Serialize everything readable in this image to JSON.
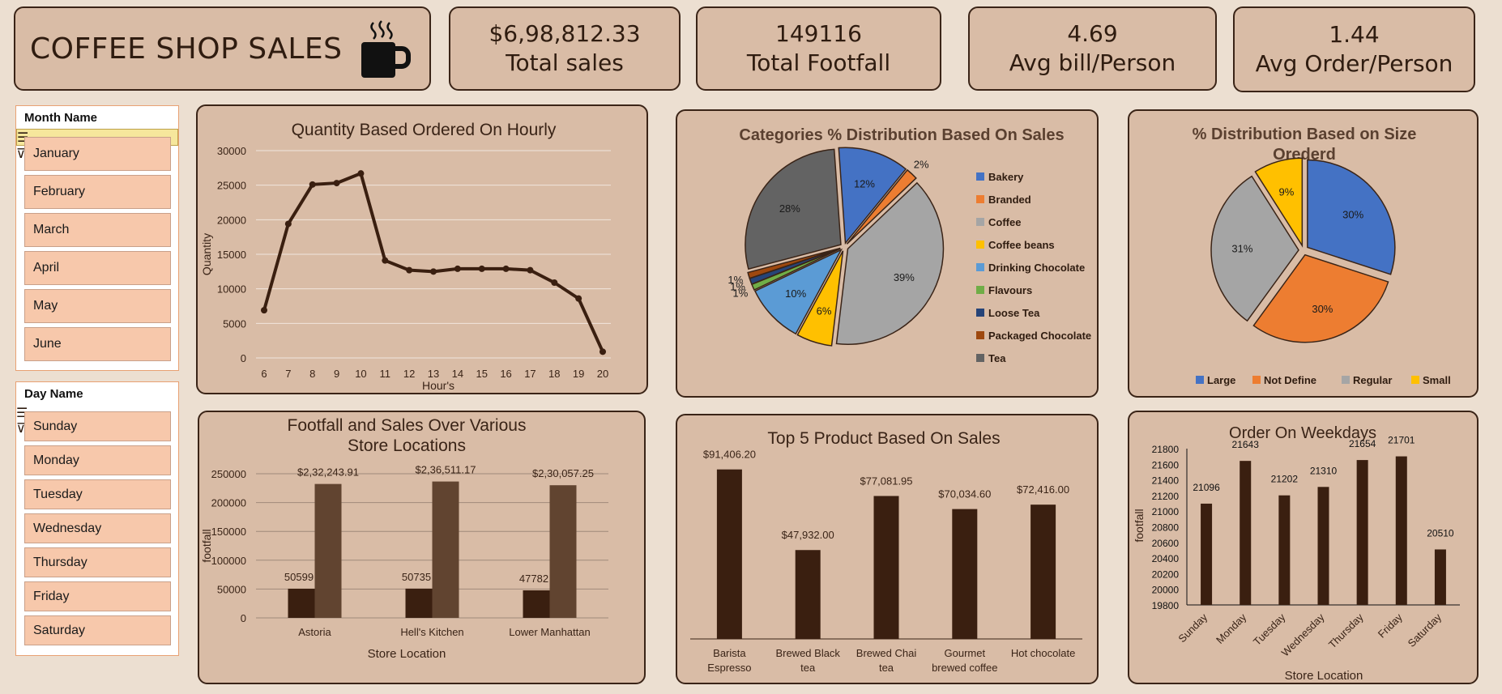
{
  "header": {
    "title": "COFFEE SHOP SALES"
  },
  "kpis": [
    {
      "value": "$6,98,812.33",
      "label": "Total sales"
    },
    {
      "value": "149116",
      "label": "Total Footfall"
    },
    {
      "value": "4.69",
      "label": "Avg bill/Person"
    },
    {
      "value": "1.44",
      "label": "Avg Order/Person"
    }
  ],
  "slicers": {
    "month": {
      "title": "Month Name",
      "items": [
        "January",
        "February",
        "March",
        "April",
        "May",
        "June"
      ]
    },
    "day": {
      "title": "Day Name",
      "items": [
        "Sunday",
        "Monday",
        "Tuesday",
        "Wednesday",
        "Thursday",
        "Friday",
        "Saturday"
      ]
    }
  },
  "colors": {
    "dark": "#3a1f10",
    "mid": "#614430",
    "card": "#d9bca6",
    "bg": "#ecdfd1"
  },
  "chart_data": [
    {
      "id": "hourly",
      "type": "line",
      "title": "Quantity Based Ordered On Hourly",
      "xlabel": "Hour's",
      "ylabel": "Quantity",
      "x": [
        6,
        7,
        8,
        9,
        10,
        11,
        12,
        13,
        14,
        15,
        16,
        17,
        18,
        19,
        20
      ],
      "values": [
        6900,
        19400,
        25100,
        25300,
        26700,
        14100,
        12700,
        12500,
        12900,
        12900,
        12900,
        12700,
        10900,
        8600,
        900
      ],
      "ylim": [
        0,
        30000
      ],
      "yticks": [
        0,
        5000,
        10000,
        15000,
        20000,
        25000,
        30000
      ],
      "grid": true
    },
    {
      "id": "categories",
      "type": "pie",
      "title": "Categories % Distribution Based On Sales",
      "legend": "right",
      "slices": [
        {
          "name": "Bakery",
          "value": 12,
          "label": "12%",
          "color": "#4472c4"
        },
        {
          "name": "Branded",
          "value": 2,
          "label": "2%",
          "color": "#ed7d31"
        },
        {
          "name": "Coffee",
          "value": 39,
          "label": "39%",
          "color": "#a5a5a5"
        },
        {
          "name": "Coffee beans",
          "value": 6,
          "label": "6%",
          "color": "#ffc000"
        },
        {
          "name": "Drinking Chocolate",
          "value": 10,
          "label": "10%",
          "color": "#5b9bd5"
        },
        {
          "name": "Flavours",
          "value": 1,
          "label": "1%",
          "color": "#70ad47"
        },
        {
          "name": "Loose Tea",
          "value": 1,
          "label": "1%",
          "color": "#264478"
        },
        {
          "name": "Packaged Chocolate",
          "value": 1,
          "label": "1%",
          "color": "#9e480e"
        },
        {
          "name": "Tea",
          "value": 28,
          "label": "28%",
          "color": "#636363"
        }
      ]
    },
    {
      "id": "size",
      "type": "pie",
      "title": "% Distribution Based on Size Orederd",
      "legend": "bottom",
      "slices": [
        {
          "name": "Large",
          "value": 30,
          "label": "30%",
          "color": "#4472c4"
        },
        {
          "name": "Not Define",
          "value": 30,
          "label": "30%",
          "color": "#ed7d31"
        },
        {
          "name": "Regular",
          "value": 31,
          "label": "31%",
          "color": "#a5a5a5"
        },
        {
          "name": "Small",
          "value": 9,
          "label": "9%",
          "color": "#ffc000"
        }
      ]
    },
    {
      "id": "stores",
      "type": "bar",
      "title": "Footfall and Sales Over Various Store Locations",
      "xlabel": "Store Location",
      "ylabel": "footfall",
      "categories": [
        "Astoria",
        "Hell's Kitchen",
        "Lower Manhattan"
      ],
      "series": [
        {
          "values": [
            50599,
            50735,
            47782
          ],
          "labels": [
            "50599",
            "50735",
            "47782"
          ],
          "color": "#3a1f10"
        },
        {
          "values": [
            232243.91,
            236511.17,
            230057.25
          ],
          "labels": [
            "$2,32,243.91",
            "$2,36,511.17",
            "$2,30,057.25"
          ],
          "color": "#614430"
        }
      ],
      "ylim": [
        0,
        250000
      ],
      "yticks": [
        0,
        50000,
        100000,
        150000,
        200000,
        250000
      ],
      "grid": true
    },
    {
      "id": "products",
      "type": "bar",
      "title": "Top 5 Product Based On Sales",
      "categories": [
        "Barista Espresso",
        "Brewed Black tea",
        "Brewed Chai tea",
        "Gourmet brewed coffee",
        "Hot chocolate"
      ],
      "values": [
        91406.2,
        47932.0,
        77081.95,
        70034.6,
        72416.0
      ],
      "labels": [
        "$91,406.20",
        "$47,932.00",
        "$77,081.95",
        "$70,034.60",
        "$72,416.00"
      ],
      "ylim": [
        0,
        100000
      ]
    },
    {
      "id": "weekdays",
      "type": "bar",
      "title": "Order On Weekdays",
      "xlabel": "Store Location",
      "ylabel": "footfall",
      "categories": [
        "Sunday",
        "Monday",
        "Tuesday",
        "Wednesday",
        "Thursday",
        "Friday",
        "Saturday"
      ],
      "values": [
        21096,
        21643,
        21202,
        21310,
        21654,
        21701,
        20510
      ],
      "labels": [
        "21096",
        "21643",
        "21202",
        "21310",
        "21654",
        "21701",
        "20510"
      ],
      "ylim": [
        19800,
        21800
      ],
      "yticks": [
        19800,
        20000,
        20200,
        20400,
        20600,
        20800,
        21000,
        21200,
        21400,
        21600,
        21800
      ]
    }
  ]
}
